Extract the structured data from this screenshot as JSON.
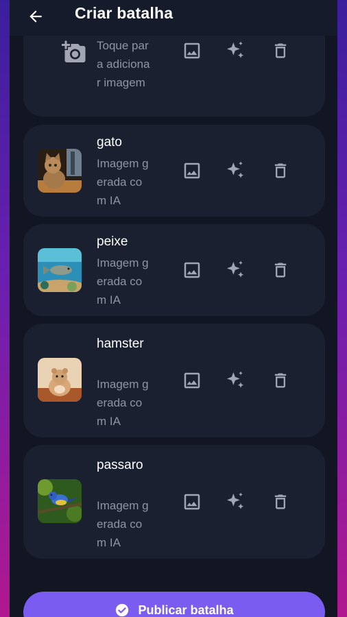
{
  "header": {
    "title": "Criar batalha"
  },
  "items": [
    {
      "name": "",
      "subtitle": "Toque para adicionar imagem"
    },
    {
      "name": "gato",
      "subtitle": "Imagem gerada com IA"
    },
    {
      "name": "peixe",
      "subtitle": "Imagem gerada com IA"
    },
    {
      "name": "hamster",
      "subtitle": "Imagem gerada com IA"
    },
    {
      "name": "passaro",
      "subtitle": "Imagem gerada com IA"
    }
  ],
  "publish": {
    "label": "Publicar batalha"
  },
  "icons": {
    "back": "arrow-back-icon",
    "camera": "add-photo-icon",
    "image": "image-icon",
    "ai": "sparkles-icon",
    "delete": "trash-icon",
    "publish": "check-circle-icon"
  },
  "colors": {
    "background": "#121622",
    "card": "#1b2030",
    "accent": "#7a5cf0",
    "text_secondary": "#8e94a6",
    "icon": "#a2a6b4"
  }
}
